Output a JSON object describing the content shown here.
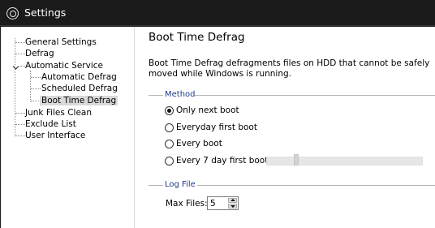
{
  "window": {
    "title": "Settings"
  },
  "sidebar": {
    "items": [
      {
        "label": "General Settings"
      },
      {
        "label": "Defrag"
      },
      {
        "label": "Automatic Service"
      },
      {
        "label": "Automatic Defrag"
      },
      {
        "label": "Scheduled Defrag"
      },
      {
        "label": "Boot Time Defrag"
      },
      {
        "label": "Junk Files Clean"
      },
      {
        "label": "Exclude List"
      },
      {
        "label": "User Interface"
      }
    ],
    "selected": "Boot Time Defrag"
  },
  "page": {
    "title": "Boot Time Defrag",
    "description": "Boot Time Defrag defragments files on HDD that cannot be safely moved while Windows is running."
  },
  "method": {
    "label": "Method",
    "options": [
      {
        "label": "Only next boot",
        "checked": true
      },
      {
        "label": "Everyday first boot",
        "checked": false
      },
      {
        "label": "Every boot",
        "checked": false
      },
      {
        "label": "Every 7 day first boot",
        "checked": false
      }
    ],
    "slider_level": 0.18
  },
  "log_file": {
    "label": "Log File",
    "max_files_label": "Max Files:",
    "max_files_value": "5"
  },
  "colors": {
    "titlebar": "#1b1b1b",
    "group_label": "#1e3a8a",
    "selected_item": "#d9d9d9"
  },
  "icons": {
    "app": "defrag-app-icon",
    "expand": "chevron-down-icon",
    "spin_up": "triangle-up-icon",
    "spin_down": "triangle-down-icon"
  }
}
